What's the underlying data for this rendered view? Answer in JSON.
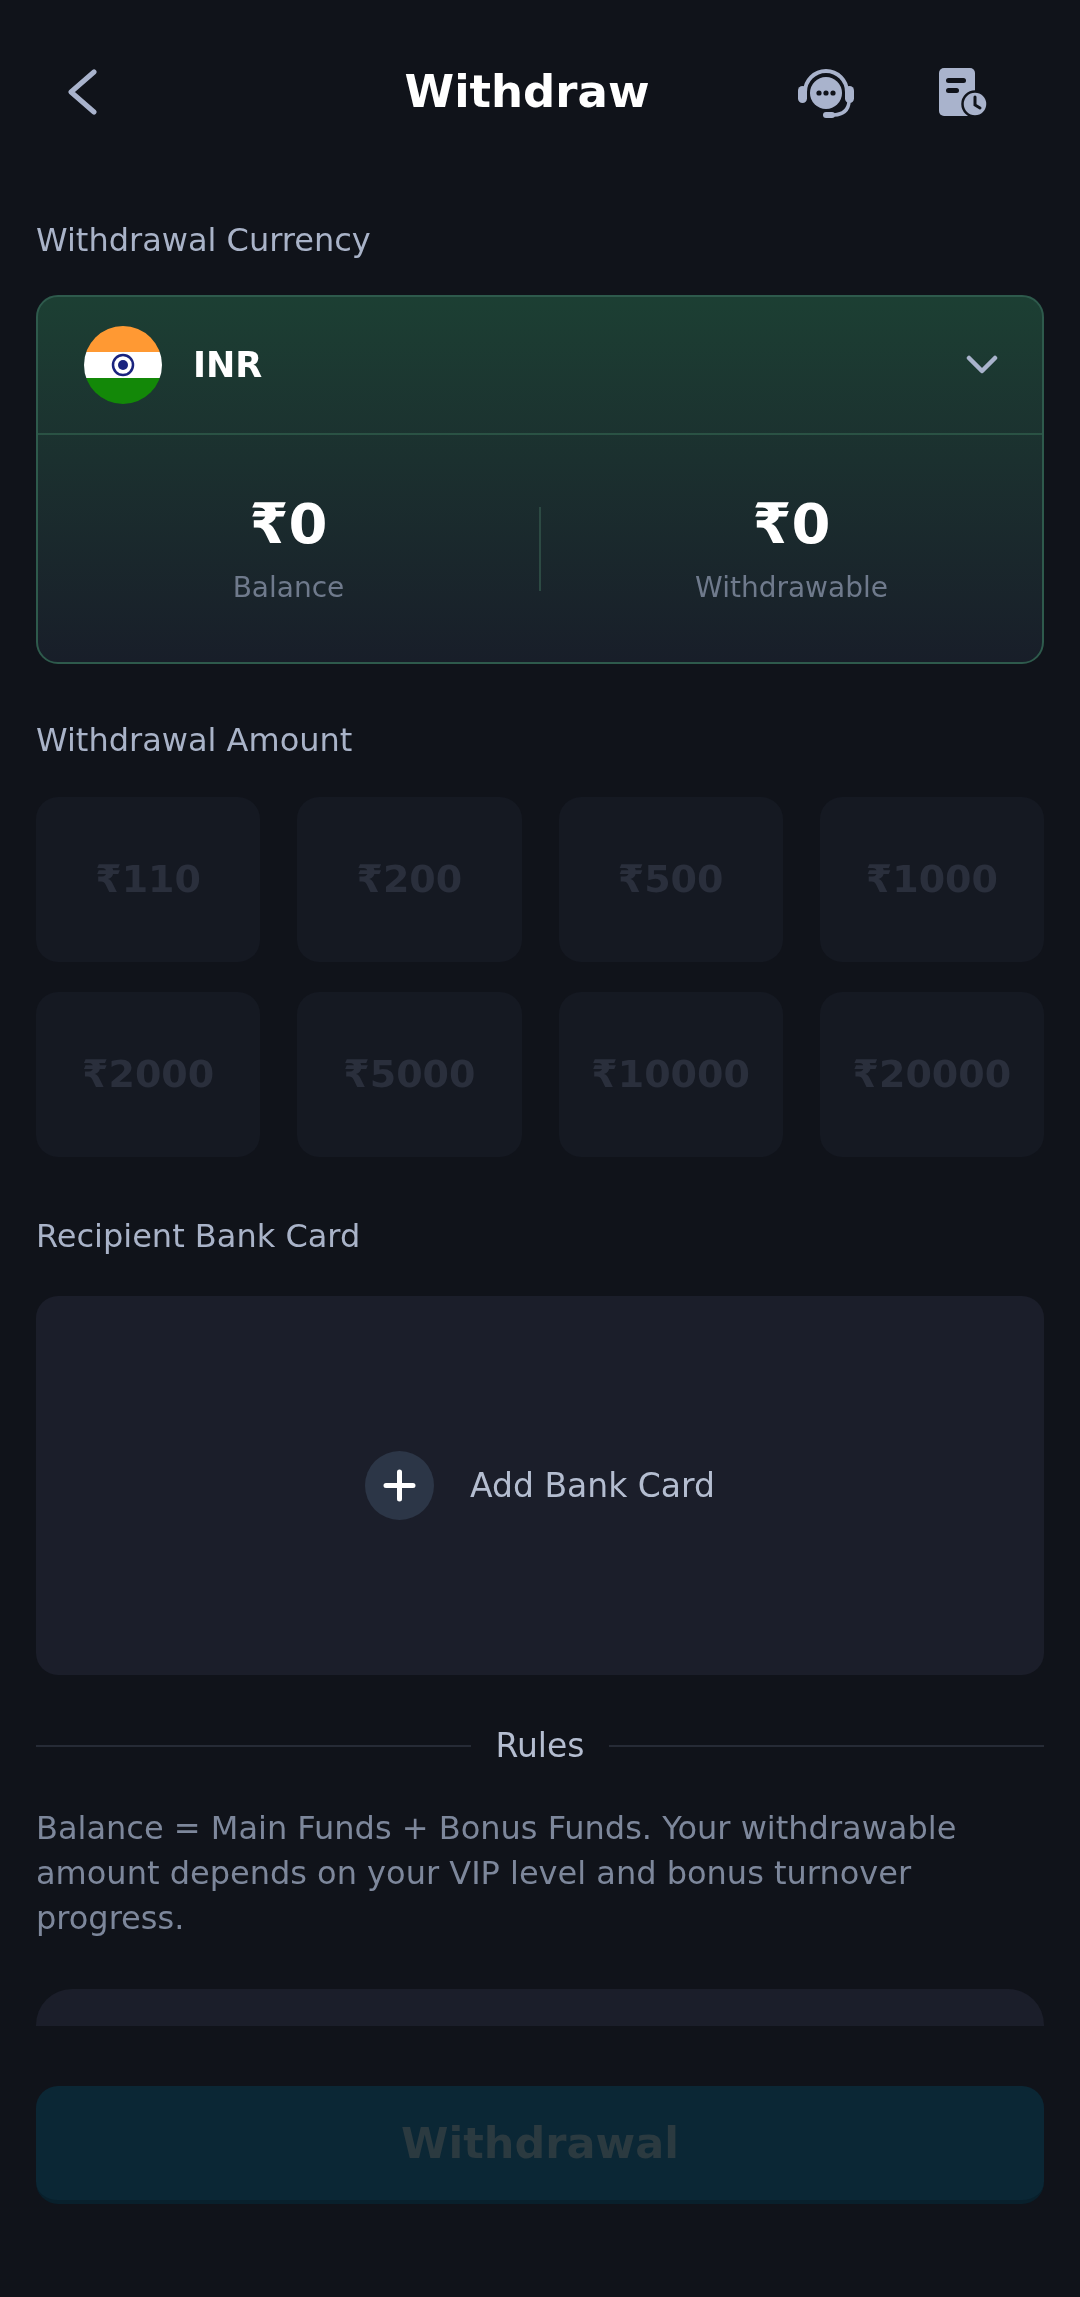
{
  "header": {
    "title": "Withdraw"
  },
  "currency": {
    "label": "Withdrawal Currency",
    "code": "INR",
    "balances": [
      {
        "amount": "₹0",
        "label": "Balance"
      },
      {
        "amount": "₹0",
        "label": "Withdrawable"
      }
    ]
  },
  "amount": {
    "label": "Withdrawal Amount",
    "options": [
      {
        "label": "₹110",
        "selected": false,
        "disabled": true
      },
      {
        "label": "₹200",
        "selected": false,
        "disabled": true
      },
      {
        "label": "₹500",
        "selected": false,
        "disabled": true
      },
      {
        "label": "₹1000",
        "selected": false,
        "disabled": true
      },
      {
        "label": "₹2000",
        "selected": false,
        "disabled": true
      },
      {
        "label": "₹5000",
        "selected": false,
        "disabled": true
      },
      {
        "label": "₹10000",
        "selected": false,
        "disabled": true
      },
      {
        "label": "₹20000",
        "selected": false,
        "disabled": true
      }
    ]
  },
  "bank_card": {
    "label": "Recipient Bank Card",
    "action": "Add Bank Card"
  },
  "rules": {
    "title": "Rules",
    "text": "Balance = Main Funds + Bonus Funds. Your withdrawable amount depends on your VIP level and bonus turnover progress."
  },
  "submit": {
    "label": "Withdrawal",
    "disabled": true
  }
}
